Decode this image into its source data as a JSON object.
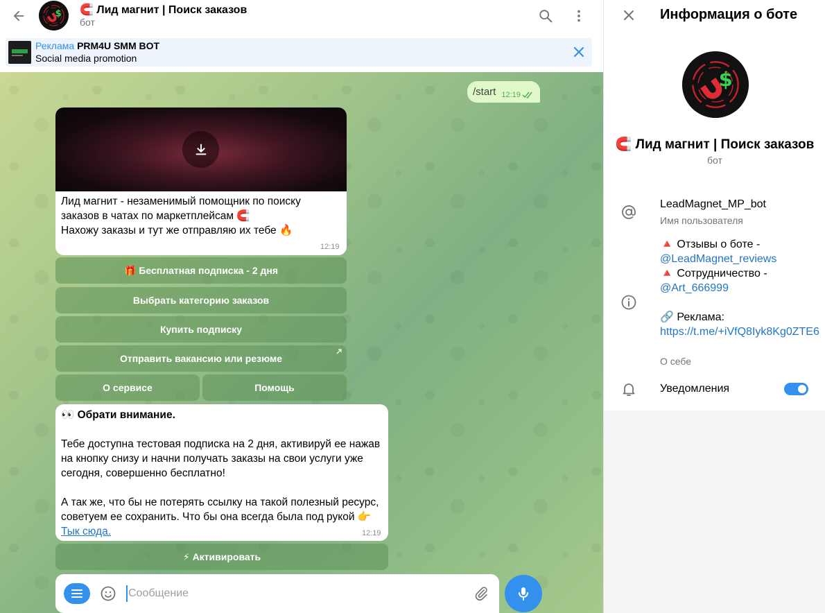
{
  "header": {
    "title": "🧲 Лид магнит | Поиск заказов",
    "subtitle": "бот"
  },
  "ad": {
    "label": "Реклама",
    "name": "PRM4U SMM BOT",
    "description": "Social media promotion"
  },
  "outgoing_message": {
    "text": "/start",
    "time": "12:19"
  },
  "message1": {
    "lines": [
      "Лид магнит - незаменимый помощник по поиску заказов в чатах по маркетплейсам 🧲",
      "",
      "Нахожу заказы и тут же отправляю их тебе 🔥"
    ],
    "time": "12:19"
  },
  "keyboard1": {
    "free_trial": "🎁 Бесплатная подписка - 2 дня",
    "choose_category": "Выбрать категорию заказов",
    "buy_subscription": "Купить подписку",
    "send_vacancy": "Отправить вакансию или резюме",
    "about": "О сервисе",
    "help": "Помощь"
  },
  "message2": {
    "heading_emoji": "👀 ",
    "heading": "Обрати внимание.",
    "para1": "Тебе доступна тестовая подписка на 2 дня, активируй ее нажав на кнопку снизу и начни получать заказы на свои услуги уже сегодня, совершенно бесплатно!",
    "para2": "А так же, что бы не потерять ссылку на такой полезный ресурс, советуем ее сохранить. Что бы она всегда была под рукой 👉 ",
    "link": "Тык сюда.",
    "time": "12:19"
  },
  "keyboard2": {
    "activate": "⚡ Активировать"
  },
  "composer": {
    "placeholder": "Сообщение"
  },
  "panel": {
    "title": "Информация о боте",
    "bot_name": "🧲 Лид магнит | Поиск заказов",
    "bot_sub": "бот",
    "username": "LeadMagnet_MP_bot",
    "username_caption": "Имя пользователя",
    "bio_reviews": "🔺 Отзывы о боте - ",
    "bio_reviews_link": "@LeadMagnet_reviews",
    "bio_coop": "🔺 Сотрудничество - ",
    "bio_coop_link": "@Art_666999",
    "bio_ads": "🔗 Реклама:",
    "bio_ads_link": "https://t.me/+iVfQ8Iyk8Kg0ZTE6",
    "bio_caption": "О себе",
    "notifications_label": "Уведомления"
  },
  "colors": {
    "accent": "#3390ec",
    "outgoing_bubble": "#e1f8c9",
    "link": "#2275c7"
  }
}
